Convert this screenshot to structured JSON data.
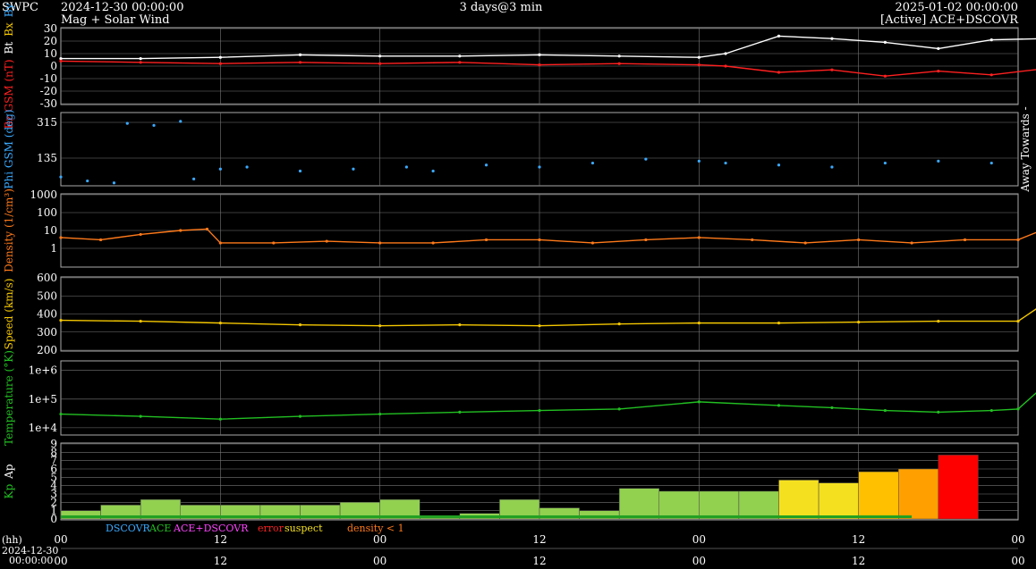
{
  "header": {
    "org": "SWPC",
    "start_time": "2024-12-30 00:00:00",
    "subtitle": "Mag + Solar Wind",
    "window": "3 days@3 min",
    "end_time": "2025-01-02 00:00:00",
    "source_status": "[Active] ACE+DSCOVR"
  },
  "colors": {
    "bz": "#ff2020",
    "bt": "#ffffff",
    "phi": "#3aaaff",
    "density": "#ff7a1a",
    "speed": "#f5c800",
    "temperature": "#22c022",
    "kp_green": "#92d050",
    "kp_yellow": "#f5e020",
    "kp_orange": "#ffa000",
    "kp_red": "#ff0000",
    "grid": "#777777"
  },
  "legend": {
    "dscovr": "DSCOVR",
    "ace": "ACE",
    "ace_dscovr": "ACE+DSCOVR",
    "error": "error",
    "suspect": "suspect",
    "density_lt_1": "density < 1"
  },
  "axis_time": {
    "hh_label": "(hh)",
    "start_date": "2024-12-30",
    "start_clock": "00:00:00",
    "ticks": [
      "00",
      "12",
      "00",
      "12",
      "00",
      "12",
      "00"
    ]
  },
  "chart_data": [
    {
      "type": "line",
      "id": "bz_bt",
      "ylabel_parts": [
        "Bz GSM (nT)",
        "Bt",
        "Bx",
        "By"
      ],
      "yticks": [
        30,
        20,
        10,
        0,
        -10,
        -20,
        -30
      ],
      "ylim": [
        -30,
        30
      ],
      "x_unit": "hours since 2024-12-30 00:00",
      "series": [
        {
          "name": "Bt",
          "points": [
            [
              0,
              6
            ],
            [
              6,
              6
            ],
            [
              12,
              7
            ],
            [
              18,
              9
            ],
            [
              24,
              8
            ],
            [
              30,
              8
            ],
            [
              36,
              9
            ],
            [
              42,
              8
            ],
            [
              48,
              7
            ],
            [
              50,
              10
            ],
            [
              54,
              24
            ],
            [
              58,
              22
            ],
            [
              62,
              19
            ],
            [
              66,
              14
            ],
            [
              70,
              21
            ],
            [
              74,
              22
            ],
            [
              78,
              17
            ],
            [
              80,
              20
            ],
            [
              84,
              23
            ],
            [
              88,
              24
            ],
            [
              90,
              22
            ],
            [
              94,
              20
            ],
            [
              96,
              25
            ],
            [
              102,
              24
            ],
            [
              106,
              23
            ],
            [
              108,
              20
            ],
            [
              110,
              16
            ]
          ]
        },
        {
          "name": "Bz",
          "points": [
            [
              0,
              4
            ],
            [
              6,
              3
            ],
            [
              12,
              2
            ],
            [
              18,
              3
            ],
            [
              24,
              2
            ],
            [
              30,
              3
            ],
            [
              36,
              1
            ],
            [
              42,
              2
            ],
            [
              48,
              1
            ],
            [
              50,
              0
            ],
            [
              54,
              -5
            ],
            [
              58,
              -3
            ],
            [
              62,
              -8
            ],
            [
              66,
              -4
            ],
            [
              70,
              -7
            ],
            [
              74,
              -2
            ],
            [
              78,
              -4
            ],
            [
              80,
              8
            ],
            [
              84,
              5
            ],
            [
              88,
              -15
            ],
            [
              90,
              -18
            ],
            [
              94,
              -20
            ],
            [
              96,
              -20
            ],
            [
              102,
              -22
            ],
            [
              106,
              -20
            ],
            [
              108,
              2
            ],
            [
              110,
              1
            ]
          ]
        }
      ]
    },
    {
      "type": "scatter",
      "id": "phi",
      "ylabel": "Phi GSM (deg)",
      "side_label": "Away Towards -",
      "yticks": [
        315,
        135
      ],
      "ylim": [
        0,
        360
      ],
      "x_unit": "hours since 2024-12-30 00:00",
      "series": [
        {
          "name": "Phi",
          "points": [
            [
              0,
              40
            ],
            [
              2,
              20
            ],
            [
              4,
              10
            ],
            [
              5,
              310
            ],
            [
              7,
              300
            ],
            [
              9,
              320
            ],
            [
              10,
              30
            ],
            [
              12,
              80
            ],
            [
              14,
              90
            ],
            [
              18,
              70
            ],
            [
              22,
              80
            ],
            [
              26,
              90
            ],
            [
              28,
              70
            ],
            [
              32,
              100
            ],
            [
              36,
              90
            ],
            [
              40,
              110
            ],
            [
              44,
              130
            ],
            [
              48,
              120
            ],
            [
              50,
              110
            ],
            [
              54,
              100
            ],
            [
              58,
              90
            ],
            [
              62,
              110
            ],
            [
              66,
              120
            ],
            [
              70,
              110
            ],
            [
              74,
              80
            ],
            [
              78,
              90
            ],
            [
              80,
              130
            ],
            [
              84,
              320
            ],
            [
              86,
              300
            ],
            [
              88,
              280
            ],
            [
              90,
              260
            ],
            [
              92,
              100
            ],
            [
              94,
              120
            ],
            [
              96,
              110
            ],
            [
              100,
              150
            ],
            [
              102,
              180
            ],
            [
              106,
              310
            ],
            [
              108,
              290
            ],
            [
              110,
              300
            ]
          ]
        }
      ]
    },
    {
      "type": "line",
      "id": "density",
      "ylabel": "Density (1/cm³)",
      "yticks": [
        "1000",
        "100",
        "10",
        "1"
      ],
      "yscale": "log",
      "ylim": [
        0.1,
        1000
      ],
      "x_unit": "hours since 2024-12-30 00:00",
      "series": [
        {
          "name": "Density",
          "points": [
            [
              0,
              4
            ],
            [
              3,
              3
            ],
            [
              6,
              6
            ],
            [
              9,
              10
            ],
            [
              11,
              12
            ],
            [
              12,
              2
            ],
            [
              16,
              2
            ],
            [
              20,
              2.5
            ],
            [
              24,
              2
            ],
            [
              28,
              2
            ],
            [
              32,
              3
            ],
            [
              36,
              3
            ],
            [
              40,
              2
            ],
            [
              44,
              3
            ],
            [
              48,
              4
            ],
            [
              52,
              3
            ],
            [
              56,
              2
            ],
            [
              60,
              3
            ],
            [
              64,
              2
            ],
            [
              68,
              3
            ],
            [
              72,
              3
            ],
            [
              74,
              12
            ],
            [
              78,
              10
            ],
            [
              82,
              11
            ],
            [
              86,
              10
            ],
            [
              90,
              9
            ],
            [
              94,
              10
            ],
            [
              96,
              11
            ],
            [
              100,
              10
            ],
            [
              104,
              12
            ],
            [
              106,
              9
            ],
            [
              108,
              25
            ],
            [
              110,
              20
            ],
            [
              112,
              9
            ]
          ]
        }
      ]
    },
    {
      "type": "line",
      "id": "speed",
      "ylabel": "Speed (km/s)",
      "yticks": [
        600,
        500,
        400,
        300,
        200
      ],
      "ylim": [
        200,
        600
      ],
      "x_unit": "hours since 2024-12-30 00:00",
      "series": [
        {
          "name": "Speed",
          "points": [
            [
              0,
              365
            ],
            [
              6,
              360
            ],
            [
              12,
              350
            ],
            [
              18,
              340
            ],
            [
              24,
              335
            ],
            [
              30,
              340
            ],
            [
              36,
              335
            ],
            [
              42,
              345
            ],
            [
              48,
              350
            ],
            [
              54,
              350
            ],
            [
              60,
              355
            ],
            [
              66,
              360
            ],
            [
              72,
              360
            ],
            [
              74,
              460
            ],
            [
              78,
              440
            ],
            [
              82,
              450
            ],
            [
              86,
              440
            ],
            [
              90,
              430
            ],
            [
              94,
              420
            ],
            [
              98,
              440
            ],
            [
              100,
              460
            ],
            [
              104,
              500
            ],
            [
              108,
              520
            ],
            [
              110,
              530
            ],
            [
              114,
              510
            ],
            [
              118,
              500
            ],
            [
              122,
              520
            ],
            [
              126,
              525
            ],
            [
              128,
              530
            ]
          ]
        }
      ]
    },
    {
      "type": "line",
      "id": "temperature",
      "ylabel": "Temperature (°K)",
      "yticks": [
        "1e+6",
        "1e+5",
        "1e+4"
      ],
      "yscale": "log",
      "ylim": [
        6000,
        2000000
      ],
      "x_unit": "hours since 2024-12-30 00:00",
      "series": [
        {
          "name": "Temperature",
          "points": [
            [
              0,
              30000
            ],
            [
              6,
              25000
            ],
            [
              12,
              20000
            ],
            [
              18,
              25000
            ],
            [
              24,
              30000
            ],
            [
              30,
              35000
            ],
            [
              36,
              40000
            ],
            [
              42,
              45000
            ],
            [
              48,
              80000
            ],
            [
              54,
              60000
            ],
            [
              58,
              50000
            ],
            [
              62,
              40000
            ],
            [
              66,
              35000
            ],
            [
              70,
              40000
            ],
            [
              72,
              45000
            ],
            [
              74,
              300000
            ],
            [
              78,
              250000
            ],
            [
              82,
              220000
            ],
            [
              86,
              200000
            ],
            [
              90,
              180000
            ],
            [
              94,
              200000
            ],
            [
              98,
              160000
            ],
            [
              100,
              120000
            ],
            [
              104,
              180000
            ],
            [
              108,
              200000
            ],
            [
              110,
              80000
            ],
            [
              114,
              200000
            ],
            [
              118,
              220000
            ],
            [
              122,
              150000
            ],
            [
              126,
              40000
            ],
            [
              128,
              30000
            ]
          ]
        }
      ]
    },
    {
      "type": "bar",
      "id": "kp",
      "ylabel_parts": [
        "Kp",
        "Ap"
      ],
      "yticks": [
        9,
        8,
        7,
        6,
        5,
        4,
        3,
        2,
        1,
        0
      ],
      "ylim": [
        0,
        9
      ],
      "categories": [
        "2024-12-30 00",
        "03",
        "06",
        "09",
        "12",
        "15",
        "18",
        "21",
        "2024-12-31 00",
        "03",
        "06",
        "09",
        "12",
        "15",
        "18",
        "21",
        "2025-01-01 00",
        "03",
        "06",
        "09",
        "12",
        "15",
        "18",
        "21"
      ],
      "values": [
        1.0,
        1.67,
        2.33,
        1.67,
        1.67,
        1.67,
        1.67,
        2.0,
        2.33,
        0.33,
        0.67,
        2.33,
        1.33,
        1.0,
        3.67,
        3.33,
        3.33,
        3.33,
        4.67,
        4.33,
        5.67,
        6.0,
        7.67,
        0
      ]
    }
  ]
}
